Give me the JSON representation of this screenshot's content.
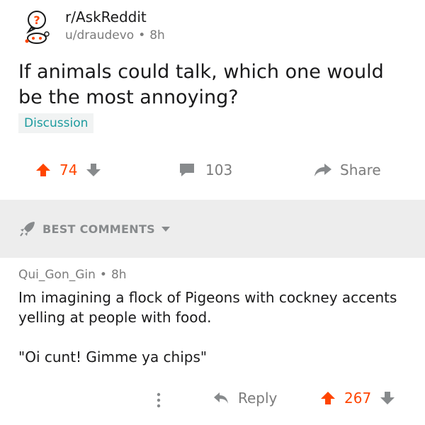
{
  "post": {
    "subreddit": "r/AskReddit",
    "author": "u/draudevo",
    "separator": "•",
    "age": "8h",
    "title": "If animals could talk, which one would be the most annoying?",
    "flair": "Discussion",
    "score": "74",
    "comment_count": "103",
    "share_label": "Share"
  },
  "sort": {
    "label": "BEST COMMENTS"
  },
  "comment": {
    "author": "Qui_Gon_Gin",
    "separator": "•",
    "age": "8h",
    "body_line1": "Im imagining a flock of Pigeons with cockney accents yelling at people with food.",
    "body_line2": "\"Oi cunt! Gimme ya chips\"",
    "reply_label": "Reply",
    "score": "267"
  },
  "colors": {
    "upvote": "#ff4500",
    "flair_text": "#1c9b9e",
    "muted": "#7c7c7c",
    "sort_bar_bg": "#ededed"
  },
  "icons": {
    "subreddit": "askreddit-snoo-icon",
    "upvote": "arrow-up-icon",
    "downvote": "arrow-down-icon",
    "comments": "comment-bubble-icon",
    "share": "share-arrow-icon",
    "sort": "rocket-icon",
    "dropdown": "caret-down-icon",
    "more": "vertical-dots-icon",
    "reply": "reply-arrow-icon"
  }
}
